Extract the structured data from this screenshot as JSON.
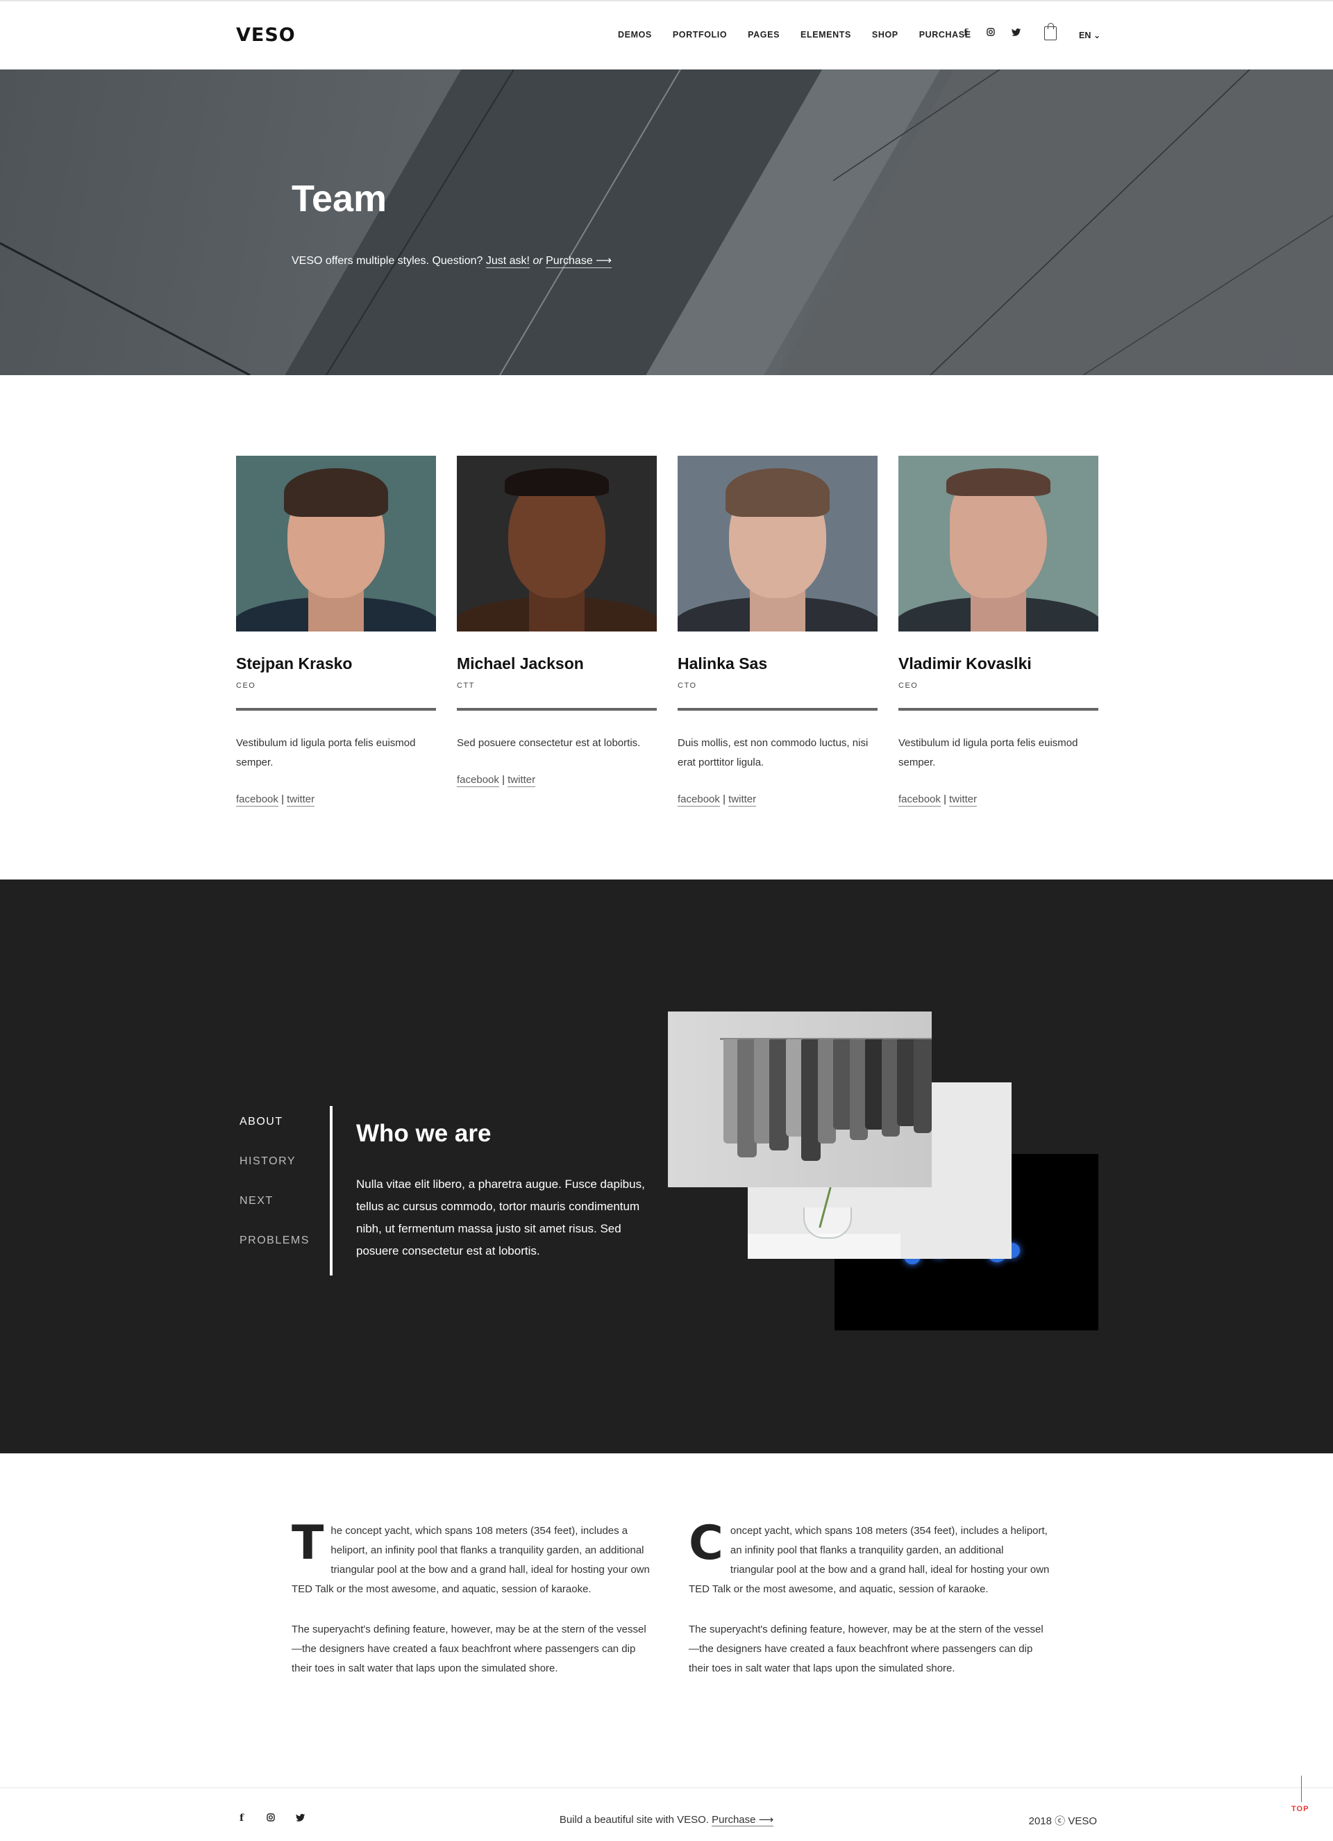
{
  "brand": {
    "logo": "VESO",
    "accent": "#e53935"
  },
  "nav": {
    "items": [
      "DEMOS",
      "PORTFOLIO",
      "PAGES",
      "ELEMENTS",
      "SHOP",
      "PURCHASE"
    ],
    "lang": "EN ⌄"
  },
  "social_icons": [
    "facebook-icon",
    "instagram-icon",
    "twitter-icon"
  ],
  "hero": {
    "title": "Team",
    "sub_text": "VESO offers multiple styles. Question?",
    "ask_link": "Just ask!",
    "or_text": "or",
    "purchase_link": "Purchase ⟶"
  },
  "team": [
    {
      "name": "Stejpan Krasko",
      "role": "CEO",
      "text": "Vestibulum id ligula porta felis euismod semper.",
      "facebook": "facebook",
      "twitter": "twitter"
    },
    {
      "name": "Michael Jackson",
      "role": "CTT",
      "text": "Sed posuere consectetur est at lobortis.",
      "facebook": "facebook",
      "twitter": "twitter"
    },
    {
      "name": "Halinka Sas",
      "role": "CTO",
      "text": "Duis mollis, est non commodo luctus, nisi erat porttitor ligula.",
      "facebook": "facebook",
      "twitter": "twitter"
    },
    {
      "name": "Vladimir Kovaslki",
      "role": "CEO",
      "text": "Vestibulum id ligula porta felis euismod semper.",
      "facebook": "facebook",
      "twitter": "twitter"
    }
  ],
  "links_separator": "|",
  "who": {
    "side_nav": [
      "ABOUT",
      "HISTORY",
      "NEXT",
      "PROBLEMS"
    ],
    "title": "Who we are",
    "text": "Nulla vitae elit libero, a pharetra augue. Fusce dapibus, tellus ac cursus commodo, tortor mauris condimentum nibh, ut fermentum massa justo sit amet risus. Sed posuere consectetur est at lobortis."
  },
  "articles": [
    {
      "dropcap": "T",
      "p1": "he concept yacht, which spans 108 meters (354 feet), includes a heliport, an infinity pool that flanks a tranquility garden, an additional triangular pool at the bow and a grand hall, ideal for hosting your own TED Talk or the most awesome, and aquatic, session of karaoke.",
      "p2": "The superyacht's defining feature, however, may be at the stern of the vessel—the designers have created a faux beachfront where passengers can dip their toes in salt water that laps upon the simulated shore."
    },
    {
      "dropcap": "C",
      "p1": "oncept yacht, which spans 108 meters (354 feet), includes a heliport, an infinity pool that flanks a tranquility garden, an additional triangular pool at the bow and a grand hall, ideal for hosting your own TED Talk or the most awesome, and aquatic, session of karaoke.",
      "p2": "The superyacht's defining feature, however, may be at the stern of the vessel—the designers have created a faux beachfront where passengers can dip their toes in salt water that laps upon the simulated shore."
    }
  ],
  "footer": {
    "text": "Build a beautiful site with VESO.",
    "purchase_link": "Purchase ⟶",
    "copyright": "2018 ⓒ VESO",
    "top_label": "TOP"
  }
}
